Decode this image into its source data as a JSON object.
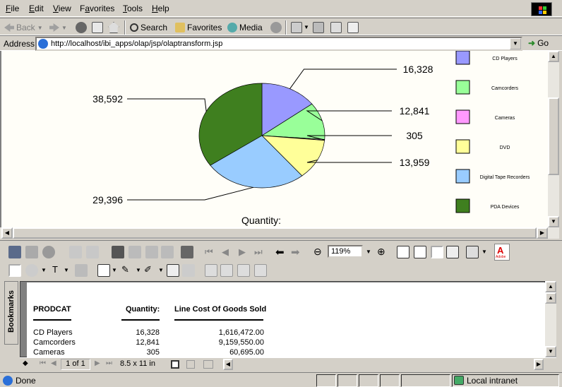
{
  "menubar": {
    "items": [
      {
        "label": "File",
        "u": "F"
      },
      {
        "label": "Edit",
        "u": "E"
      },
      {
        "label": "View",
        "u": "V"
      },
      {
        "label": "Favorites",
        "u": "a"
      },
      {
        "label": "Tools",
        "u": "T"
      },
      {
        "label": "Help",
        "u": "H"
      }
    ]
  },
  "toolbar": {
    "back_label": "Back",
    "search_label": "Search",
    "favorites_label": "Favorites",
    "media_label": "Media"
  },
  "address": {
    "label": "Address",
    "url": "http://localhost/ibi_apps/olap/jsp/olaptransform.jsp",
    "go_label": "Go"
  },
  "chart_data": {
    "type": "pie",
    "title": "Quantity:",
    "categories": [
      "CD Players",
      "Camcorders",
      "Cameras",
      "DVD",
      "Digital Tape Recorders",
      "PDA Devices"
    ],
    "values": [
      16328,
      12841,
      305,
      13959,
      29396,
      38592
    ],
    "value_labels": [
      "16,328",
      "12,841",
      "305",
      "13,959",
      "29,396",
      "38,592"
    ],
    "colors": [
      "#9999ff",
      "#99ff99",
      "#ff99ff",
      "#ffff99",
      "#99ccff",
      "#3f7f1f"
    ],
    "legend_position": "right"
  },
  "acrobat": {
    "zoom": "119%",
    "adobe_label": "Adobe",
    "bookmarks_tab": "Bookmarks",
    "page_indicator": "1 of 1",
    "page_size": "8.5 x 11 in"
  },
  "report": {
    "headers": [
      "PRODCAT",
      "Quantity:",
      "Line Cost Of Goods Sold"
    ],
    "rows": [
      [
        "CD Players",
        "16,328",
        "1,616,472.00"
      ],
      [
        "Camcorders",
        "12,841",
        "9,159,550.00"
      ],
      [
        "Cameras",
        "305",
        "60,695.00"
      ]
    ]
  },
  "status": {
    "text": "Done",
    "zone": "Local intranet"
  }
}
